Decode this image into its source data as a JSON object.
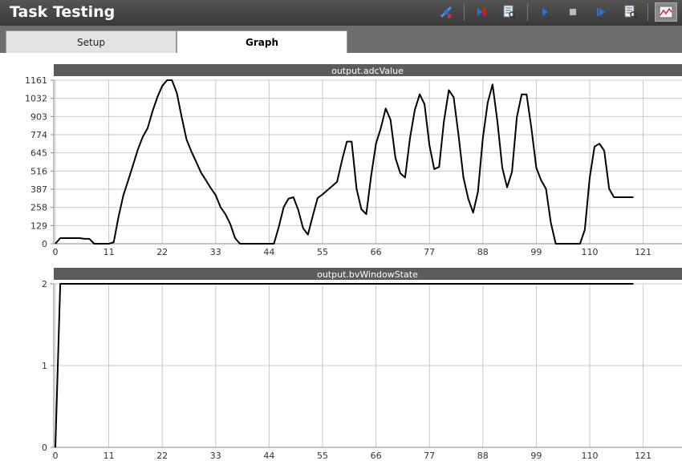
{
  "window": {
    "title": "Task Testing"
  },
  "toolbar": {
    "buttons": [
      {
        "name": "connect-icon",
        "color": "#4a8fe0"
      },
      {
        "name": "stop-record-icon",
        "color": "#d02020"
      },
      {
        "name": "document-search-icon",
        "color": "#2a5fb0"
      },
      {
        "name": "play-icon",
        "color": "#2f6fe0"
      },
      {
        "name": "stop-icon",
        "color": "#bbbbbb"
      },
      {
        "name": "step-forward-icon",
        "color": "#2f6fe0"
      },
      {
        "name": "report-icon",
        "color": "#2a5fb0"
      },
      {
        "name": "graph-view-icon",
        "color": "#c03030"
      }
    ]
  },
  "tabs": [
    {
      "label": "Setup",
      "active": false
    },
    {
      "label": "Graph",
      "active": true
    }
  ],
  "chart_data": [
    {
      "type": "line",
      "title": "output.adcValue",
      "x_ticks": [
        0,
        11,
        22,
        33,
        44,
        55,
        66,
        77,
        88,
        99,
        110,
        121
      ],
      "y_ticks": [
        0,
        129,
        258,
        387,
        516,
        645,
        774,
        903,
        1032,
        1161
      ],
      "xlim": [
        0,
        129
      ],
      "ylim": [
        0,
        1161
      ],
      "grid": true,
      "x": [
        0,
        1,
        2,
        3,
        4,
        5,
        6,
        7,
        8,
        9,
        10,
        11,
        12,
        13,
        14,
        15,
        16,
        17,
        18,
        19,
        20,
        21,
        22,
        23,
        24,
        25,
        26,
        27,
        28,
        29,
        30,
        31,
        32,
        33,
        34,
        35,
        36,
        37,
        38,
        39,
        40,
        41,
        42,
        43,
        44,
        45,
        46,
        47,
        48,
        49,
        50,
        51,
        52,
        53,
        54,
        55,
        56,
        57,
        58,
        59,
        60,
        61,
        62,
        63,
        64,
        65,
        66,
        67,
        68,
        69,
        70,
        71,
        72,
        73,
        74,
        75,
        76,
        77,
        78,
        79,
        80,
        81,
        82,
        83,
        84,
        85,
        86,
        87,
        88,
        89,
        90,
        91,
        92,
        93,
        94,
        95,
        96,
        97,
        98,
        99,
        100,
        101,
        102,
        103,
        104,
        105,
        106,
        107,
        108,
        109,
        110,
        111,
        112,
        113,
        114,
        115,
        116,
        117,
        118,
        119
      ],
      "values": [
        0,
        40,
        40,
        40,
        40,
        40,
        35,
        35,
        0,
        0,
        0,
        0,
        10,
        190,
        345,
        450,
        560,
        670,
        760,
        820,
        940,
        1040,
        1120,
        1161,
        1161,
        1070,
        900,
        740,
        655,
        580,
        505,
        450,
        395,
        345,
        260,
        210,
        140,
        40,
        0,
        0,
        0,
        0,
        0,
        0,
        0,
        0,
        120,
        260,
        320,
        330,
        240,
        110,
        65,
        200,
        325,
        350,
        380,
        410,
        440,
        590,
        725,
        725,
        390,
        245,
        210,
        480,
        710,
        820,
        960,
        880,
        610,
        500,
        470,
        750,
        950,
        1060,
        990,
        700,
        530,
        545,
        870,
        1090,
        1040,
        770,
        470,
        320,
        220,
        370,
        750,
        1000,
        1130,
        870,
        540,
        400,
        510,
        900,
        1060,
        1060,
        820,
        540,
        450,
        390,
        150,
        0,
        0,
        0,
        0,
        0,
        0,
        100,
        470,
        690,
        710,
        660,
        390,
        330,
        330,
        330,
        330,
        330
      ]
    },
    {
      "type": "line",
      "title": "output.bvWindowState",
      "x_ticks": [
        0,
        11,
        22,
        33,
        44,
        55,
        66,
        77,
        88,
        99,
        110,
        121
      ],
      "y_ticks": [
        0,
        1,
        2
      ],
      "xlim": [
        0,
        129
      ],
      "ylim": [
        0,
        2
      ],
      "grid": true,
      "x": [
        0,
        1,
        119
      ],
      "values": [
        0,
        2,
        2
      ]
    }
  ]
}
